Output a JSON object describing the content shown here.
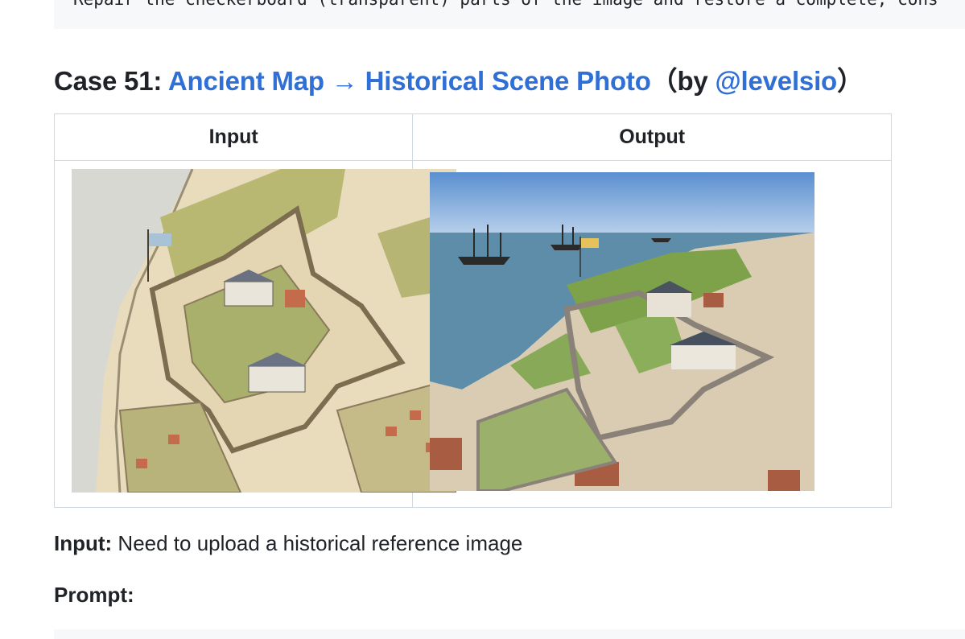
{
  "code_snippet": {
    "text": "Repair the checkerboard (transparent) parts of the image and restore a complete, cons"
  },
  "case": {
    "prefix": "Case 51: ",
    "title_link": "Ancient Map → Historical Scene Photo",
    "by_open": "（by ",
    "author_link": "@levelsio",
    "by_close": "）"
  },
  "table": {
    "headers": [
      "Input",
      "Output"
    ],
    "input_image_alt": "Illustrated ancient map of a star-shaped fort by the sea",
    "output_image_alt": "Aerial photo of a historical star fort with tall ships on the water"
  },
  "input_note": {
    "label": "Input:",
    "text": " Need to upload a historical reference image"
  },
  "prompt_label": "Prompt:",
  "colors": {
    "link": "#2f6fd6",
    "text": "#1f2328",
    "border": "#d1d9e0",
    "code_bg": "#f6f8fa"
  }
}
